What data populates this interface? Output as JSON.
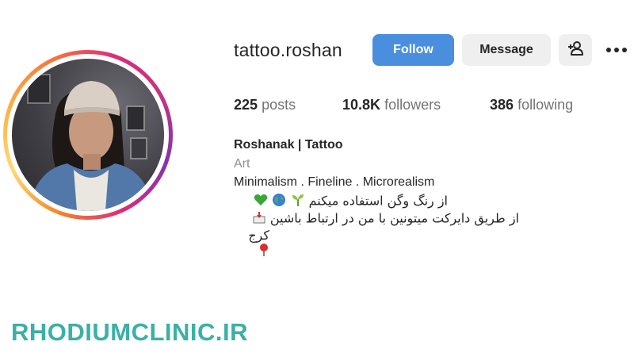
{
  "profile": {
    "username": "tattoo.roshan",
    "follow_label": "Follow",
    "message_label": "Message",
    "add_user_icon": "add-user-icon",
    "more_icon": "more-options-icon"
  },
  "stats": {
    "posts_count": "225",
    "posts_label": "posts",
    "followers_count": "10.8K",
    "followers_label": "followers",
    "following_count": "386",
    "following_label": "following"
  },
  "bio": {
    "name": "Roshanak | Tattoo",
    "category": "Art",
    "line1": "Minimalism . Fineline . Microrealism",
    "line2": "از رنگ وگن استفاده میکنم",
    "line3": "از طریق دایرکت میتونین با من در ارتباط باشین",
    "line4": "کرج"
  },
  "watermark": "RHODIUMCLINIC.IR",
  "colors": {
    "follow_button": "#4a8fde",
    "message_button": "#efefef",
    "watermark": "#3ab0a6"
  }
}
